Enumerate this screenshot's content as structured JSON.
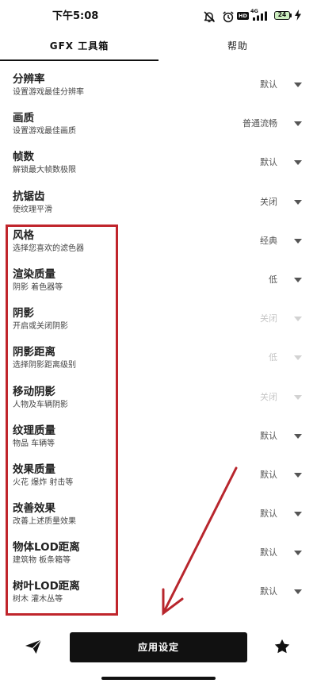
{
  "status_bar": {
    "time": "下午5:08",
    "hd_label": "HD",
    "network_label": "4G",
    "battery_level": "24",
    "icons": [
      "mute-icon",
      "alarm-icon",
      "signal-icon",
      "battery-icon",
      "charging-icon"
    ]
  },
  "tabs": [
    {
      "label": "GFX 工具箱",
      "active": true
    },
    {
      "label": "帮助",
      "active": false
    }
  ],
  "settings": [
    {
      "title": "分辨率",
      "subtitle": "设置游戏最佳分辨率",
      "value": "默认",
      "enabled": true
    },
    {
      "title": "画质",
      "subtitle": "设置游戏最佳画质",
      "value": "普通流畅",
      "enabled": true
    },
    {
      "title": "帧数",
      "subtitle": "解锁最大帧数极限",
      "value": "默认",
      "enabled": true
    },
    {
      "title": "抗锯齿",
      "subtitle": "使纹理平滑",
      "value": "关闭",
      "enabled": true
    },
    {
      "title": "风格",
      "subtitle": "选择您喜欢的滤色器",
      "value": "经典",
      "enabled": true
    },
    {
      "title": "渲染质量",
      "subtitle": "阴影 着色器等",
      "value": "低",
      "enabled": true
    },
    {
      "title": "阴影",
      "subtitle": "开启或关闭阴影",
      "value": "关闭",
      "enabled": false
    },
    {
      "title": "阴影距离",
      "subtitle": "选择阴影距离级别",
      "value": "低",
      "enabled": false
    },
    {
      "title": "移动阴影",
      "subtitle": "人物及车辆阴影",
      "value": "关闭",
      "enabled": false
    },
    {
      "title": "纹理质量",
      "subtitle": "物品 车辆等",
      "value": "默认",
      "enabled": true
    },
    {
      "title": "效果质量",
      "subtitle": "火花 爆炸 射击等",
      "value": "默认",
      "enabled": true
    },
    {
      "title": "改善效果",
      "subtitle": "改善上述质量效果",
      "value": "默认",
      "enabled": true
    },
    {
      "title": "物体LOD距离",
      "subtitle": "建筑物 板条箱等",
      "value": "默认",
      "enabled": true
    },
    {
      "title": "树叶LOD距离",
      "subtitle": "树木 灌木丛等",
      "value": "默认",
      "enabled": true
    }
  ],
  "bottom_bar": {
    "apply_button_label": "应用设定",
    "left_icon": "paper-plane-icon",
    "right_icon": "star-icon"
  },
  "colors": {
    "text_primary": "#222222",
    "text_secondary": "#444444",
    "value": "#555555",
    "value_disabled": "#c6c6c6",
    "button_bg": "#111111",
    "button_text": "#ffffff",
    "annotation": "#c0252c"
  }
}
